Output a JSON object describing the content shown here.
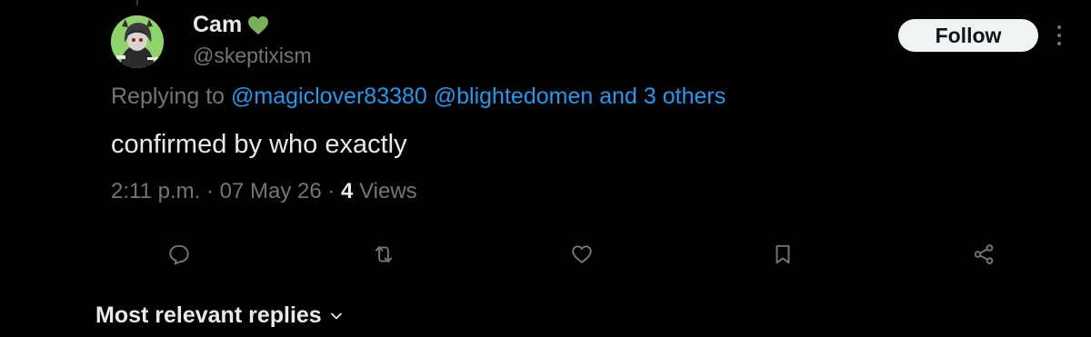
{
  "tweet": {
    "author": {
      "display_name": "Cam",
      "handle": "@skeptixism",
      "badge_icon": "green-heart-icon"
    },
    "follow_label": "Follow",
    "replying": {
      "prefix": "Replying to",
      "mention_1": "@magiclover83380",
      "mention_2": "@blightedomen",
      "suffix": "and 3 others"
    },
    "text": "confirmed by who exactly",
    "meta": {
      "time": "2:11 p.m.",
      "separator": "·",
      "date": "07 May 26",
      "views_count": "4",
      "views_label": "Views"
    },
    "actions": [
      "reply-icon",
      "retweet-icon",
      "like-icon",
      "bookmark-icon",
      "share-icon"
    ]
  },
  "replies_sort": {
    "label": "Most relevant replies",
    "icon": "chevron-down-icon"
  },
  "colors": {
    "background": "#000000",
    "text_primary": "#e7e9ea",
    "text_secondary": "#71767b",
    "link": "#1d9bf0",
    "badge": "#78b159",
    "follow_button_bg": "#eff3f4"
  }
}
